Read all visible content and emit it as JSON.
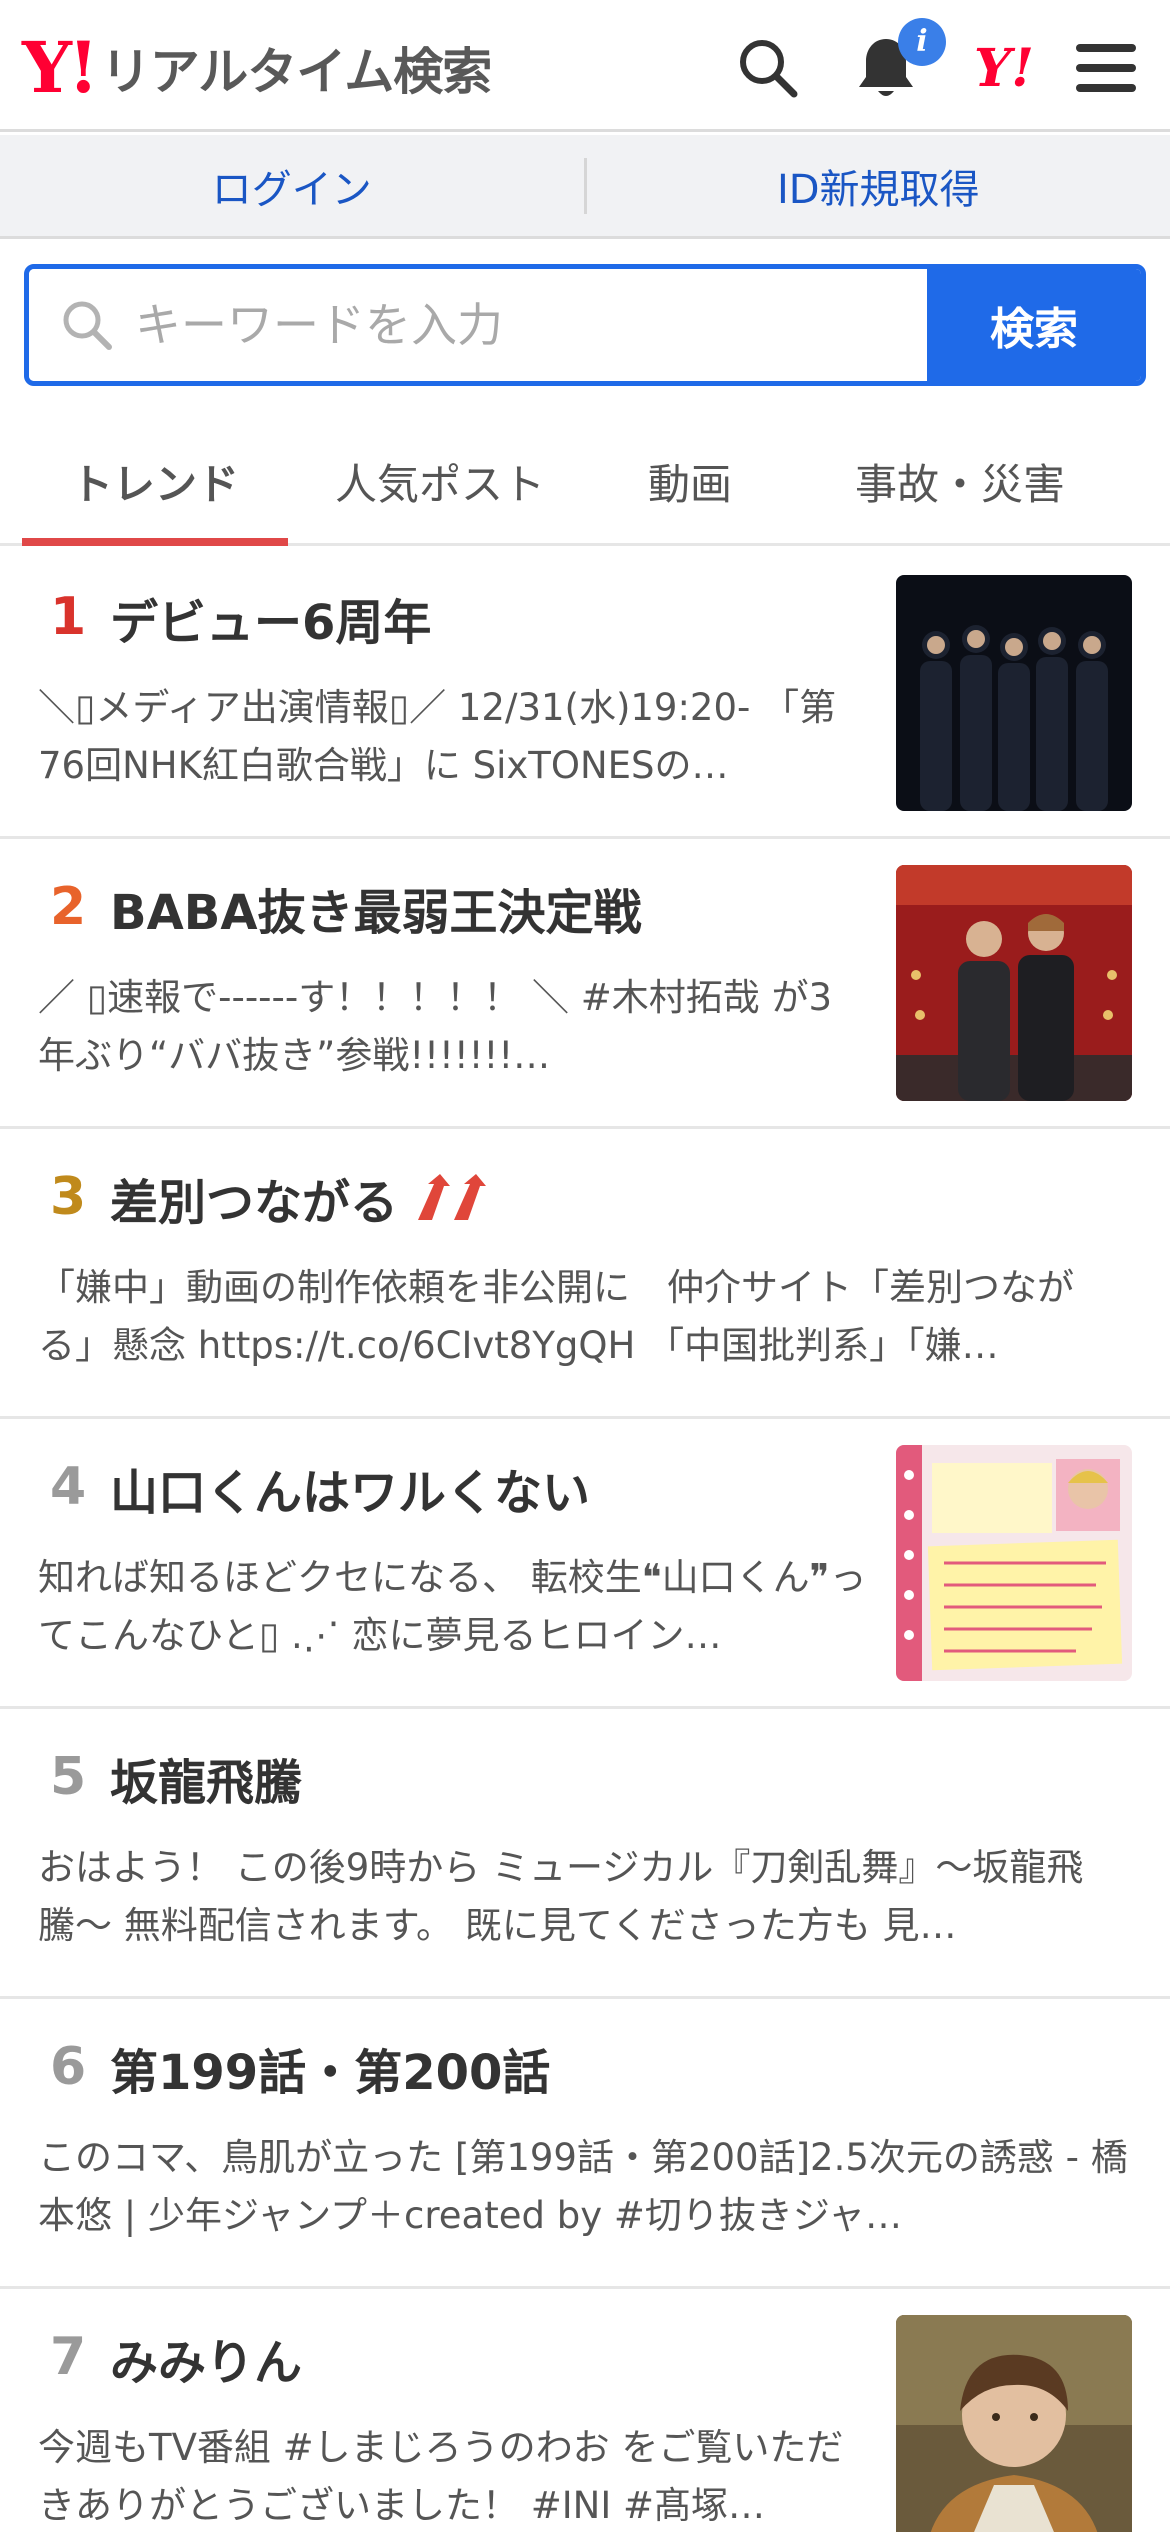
{
  "header": {
    "logo_mark": "Y!",
    "logo_text": "リアルタイム検索",
    "notification_count": "i",
    "yj_mark": "Y!"
  },
  "login_bar": {
    "login": "ログイン",
    "register": "ID新規取得"
  },
  "search": {
    "placeholder": "キーワードを入力",
    "button": "検索"
  },
  "tabs": [
    {
      "label": "トレンド",
      "active": true
    },
    {
      "label": "人気ポスト",
      "active": false
    },
    {
      "label": "動画",
      "active": false
    },
    {
      "label": "事故・災害",
      "active": false
    }
  ],
  "colors": {
    "accent": "#1f6ae8",
    "rank1": "#d9332c",
    "rank2": "#e8632b",
    "rank3": "#c08a1c",
    "rank_other": "#9a9a9a",
    "tab_indicator": "#e04848"
  },
  "trends": [
    {
      "rank": "1",
      "title": "デビュー6周年",
      "desc": "＼▯メディア出演情報▯／ 12/31(水)19:20- 「第76回NHK紅白歌合戦」に SixTONESの…",
      "thumb": "group-photo-dark"
    },
    {
      "rank": "2",
      "title": "BABA抜き最弱王決定戦",
      "desc": "／ ▯速報で------す！！！！！ ＼ #木村拓哉 が3年ぶり“ババ抜き”参戦!!!!!!!…",
      "thumb": "two-men-red-curtain"
    },
    {
      "rank": "3",
      "title": "差別つながる",
      "desc": "「嫌中」動画の制作依頼を非公開に　仲介サイト「差別つながる」懸念 https://t.co/6CIvt8YgQH 「中国批判系」「嫌…",
      "rising": true
    },
    {
      "rank": "4",
      "title": "山口くんはワルくない",
      "desc": "知れば知るほどクセになる、 転校生❝山口くん❞ってこんなひと▯ .⋰ 恋に夢見るヒロイン…",
      "thumb": "notebook-profile"
    },
    {
      "rank": "5",
      "title": "坂龍飛騰",
      "desc": "おはよう！ この後9時から ミュージカル『刀剣乱舞』〜坂龍飛騰〜 無料配信されます。 既に見てくださった方も 見…"
    },
    {
      "rank": "6",
      "title": "第199話・第200話",
      "desc": "このコマ、鳥肌が立った [第199話・第200話]2.5次元の誘惑 - 橋本悠 | 少年ジャンプ＋created by #切り抜きジャ…"
    },
    {
      "rank": "7",
      "title": "みみりん",
      "desc": "今週もTV番組 #しまじろうのわお をご覧いただきありがとうございました！ #INI #髙塚…",
      "thumb": "man-portrait"
    }
  ]
}
